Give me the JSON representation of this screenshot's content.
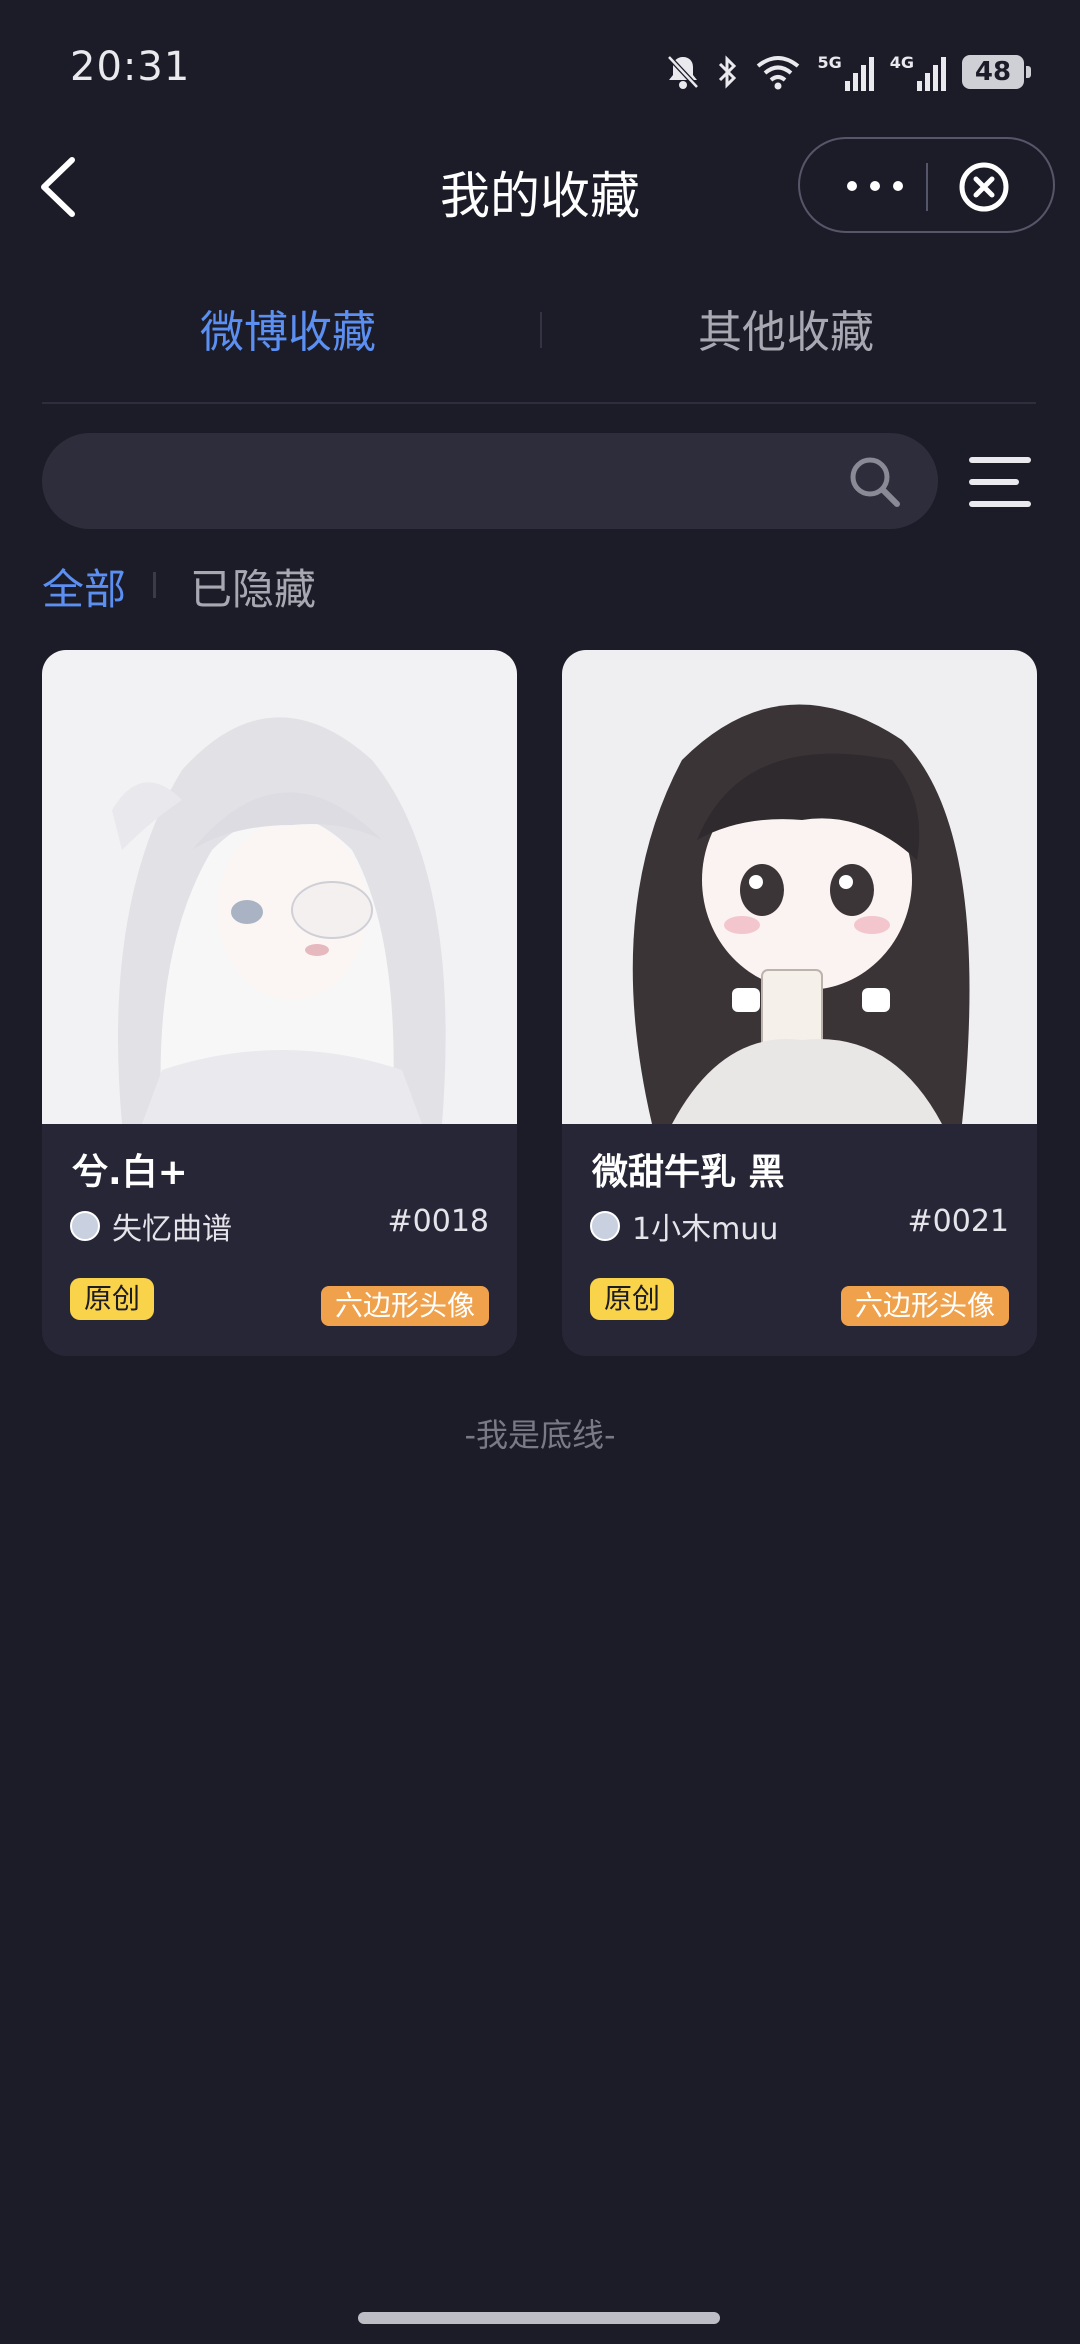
{
  "status": {
    "time": "20:31",
    "battery": "48",
    "net1": "5G",
    "net2": "4G"
  },
  "header": {
    "title": "我的收藏"
  },
  "tabs": [
    {
      "label": "微博收藏"
    },
    {
      "label": "其他收藏"
    }
  ],
  "search": {
    "placeholder": "",
    "value": ""
  },
  "filters": [
    {
      "label": "全部"
    },
    {
      "label": "已隐藏"
    }
  ],
  "cards": [
    {
      "name": "兮.白+",
      "author": "失忆曲谱",
      "number": "#0018",
      "badge_original": "原创",
      "badge_type": "六边形头像"
    },
    {
      "name": "微甜牛乳 黑",
      "author": "1小木muu",
      "number": "#0021",
      "badge_original": "原创",
      "badge_type": "六边形头像"
    }
  ],
  "footer": {
    "end_text": "-我是底线-"
  },
  "colors": {
    "background": "#1c1c28",
    "accent": "#5b8ff2",
    "badge_yellow": "#f9d34a",
    "badge_orange": "#f0a14c"
  }
}
